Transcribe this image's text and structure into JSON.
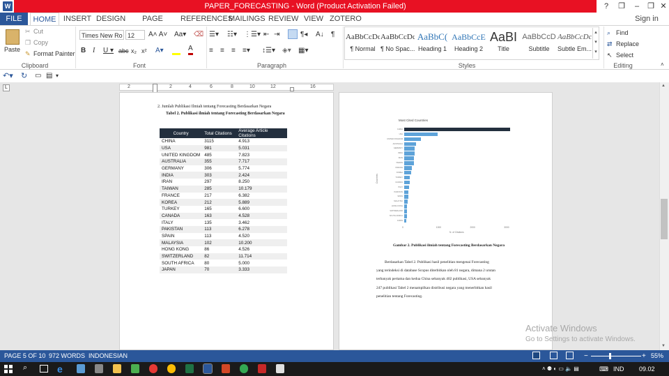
{
  "window": {
    "title": "PAPER_FORECASTING - Word (Product Activation Failed)",
    "app_icon": "W",
    "controls": [
      "?",
      "❐",
      "–",
      "❐",
      "✕"
    ]
  },
  "tabs": [
    "FILE",
    "HOME",
    "INSERT",
    "DESIGN",
    "PAGE LAYOUT",
    "REFERENCES",
    "MAILINGS",
    "REVIEW",
    "VIEW",
    "ZOTERO"
  ],
  "sign_in": "Sign in",
  "ribbon": {
    "clipboard": {
      "label": "Clipboard",
      "paste": "Paste",
      "cut": "Cut",
      "copy": "Copy",
      "format_painter": "Format Painter"
    },
    "font": {
      "label": "Font",
      "font_name": "Times New Ro",
      "font_size": "12"
    },
    "paragraph": {
      "label": "Paragraph"
    },
    "styles": {
      "label": "Styles",
      "items": [
        {
          "sample": "AaBbCcDc",
          "name": "¶ Normal"
        },
        {
          "sample": "AaBbCcDc",
          "name": "¶ No Spac..."
        },
        {
          "sample": "AaBbC(",
          "name": "Heading 1"
        },
        {
          "sample": "AaBbCcE",
          "name": "Heading 2"
        },
        {
          "sample": "AaBI",
          "name": "Title"
        },
        {
          "sample": "AaBbCcD",
          "name": "Subtitle"
        },
        {
          "sample": "AaBbCcDc",
          "name": "Subtle Em..."
        }
      ]
    },
    "editing": {
      "label": "Editing",
      "find": "Find",
      "replace": "Replace",
      "select": "Select"
    }
  },
  "ruler": [
    "2",
    "2",
    "4",
    "6",
    "8",
    "10",
    "12",
    "16"
  ],
  "document": {
    "item": "2.   Jumlah Publikasi Ilmiah tentang Forecasting Berdasarkan Negara",
    "table_caption": "Tabel 2. Publikasi ilmiah tentang Forecasting Berdasarkan Negara",
    "table": {
      "headers": [
        "Country",
        "Total Citations",
        "Average Article Citations"
      ],
      "rows": [
        [
          "CHINA",
          "3115",
          "4.913"
        ],
        [
          "USA",
          "981",
          "5.031"
        ],
        [
          "UNITED KINGDOM",
          "485",
          "7.823"
        ],
        [
          "AUSTRALIA",
          "355",
          "7.717"
        ],
        [
          "GERMANY",
          "306",
          "5.774"
        ],
        [
          "INDIA",
          "303",
          "2.424"
        ],
        [
          "IRAN",
          "297",
          "8.250"
        ],
        [
          "TAIWAN",
          "285",
          "10.179"
        ],
        [
          "FRANCE",
          "217",
          "6.382"
        ],
        [
          "KOREA",
          "212",
          "5.889"
        ],
        [
          "TURKEY",
          "165",
          "6.600"
        ],
        [
          "CANADA",
          "163",
          "4.528"
        ],
        [
          "ITALY",
          "135",
          "3.462"
        ],
        [
          "PAKISTAN",
          "113",
          "6.278"
        ],
        [
          "SPAIN",
          "113",
          "4.520"
        ],
        [
          "MALAYSIA",
          "102",
          "10.200"
        ],
        [
          "HONG KONG",
          "86",
          "4.526"
        ],
        [
          "SWITZERLAND",
          "82",
          "11.714"
        ],
        [
          "SOUTH AFRICA",
          "80",
          "5.000"
        ],
        [
          "JAPAN",
          "70",
          "3.333"
        ]
      ]
    },
    "figure_caption": "Gambar 2. Publikasi ilmiah tentang Forecasting Berdasarkan Negara",
    "paragraph_lines": [
      "Berdasarkan Tabel 2. Publikasi hasil penelitian mengenai Forecasting",
      "yang terindeksi di database Scopus diterbitkan oleh 81 negara, dimana 2 urutan",
      "terbanyak pertama dan kedua China sebanyak 402 publikasi, USA sebanyak",
      "247 publikasi Tabel 2 menampilkan distribusi negara yang menerbitkan hasil",
      "penelitian tentang Forecasting."
    ]
  },
  "chart_data": {
    "type": "bar",
    "orientation": "horizontal",
    "title": "Most Cited Countries",
    "xlabel": "N. of Citations",
    "ylabel": "Countries",
    "categories": [
      "CHINA",
      "USA",
      "UNITED KINGDOM",
      "AUSTRALIA",
      "GERMANY",
      "INDIA",
      "IRAN",
      "TAIWAN",
      "FRANCE",
      "KOREA",
      "TURKEY",
      "CANADA",
      "ITALY",
      "PAKISTAN",
      "SPAIN",
      "MALAYSIA",
      "HONG KONG",
      "SWITZERLAND",
      "SOUTH AFRICA",
      "JAPAN"
    ],
    "values": [
      3115,
      981,
      485,
      355,
      306,
      303,
      297,
      285,
      217,
      212,
      165,
      163,
      135,
      113,
      113,
      102,
      86,
      82,
      80,
      70
    ],
    "xlim": [
      0,
      3200
    ],
    "xticks": [
      "0",
      "1000",
      "2000",
      "3000"
    ],
    "highlight_color": "#232f3e",
    "bar_color": "#5ea3d9"
  },
  "watermark": {
    "title": "Activate Windows",
    "subtitle": "Go to Settings to activate Windows."
  },
  "status": {
    "page": "PAGE 5 OF 10",
    "words": "972 WORDS",
    "language": "INDONESIAN",
    "zoom": "55%"
  },
  "taskbar": {
    "language": "IND",
    "time": "09.02"
  }
}
